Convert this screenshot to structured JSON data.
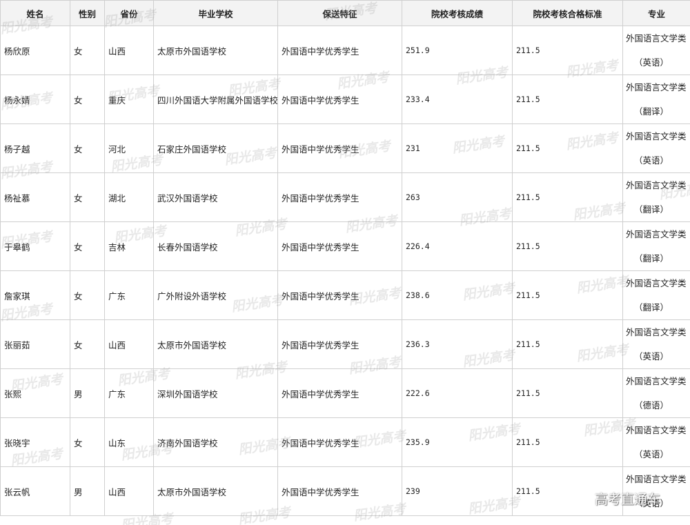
{
  "headers": {
    "name": "姓名",
    "gender": "性别",
    "province": "省份",
    "school": "毕业学校",
    "feature": "保送特征",
    "score": "院校考核成绩",
    "standard": "院校考核合格标准",
    "major": "专业"
  },
  "rows": [
    {
      "name": "杨欣原",
      "gender": "女",
      "province": "山西",
      "school": "太原市外国语学校",
      "feature": "外国语中学优秀学生",
      "score": "251.9",
      "standard": "211.5",
      "major": "外国语言文学类",
      "major_sub": "（英语）"
    },
    {
      "name": "杨永婧",
      "gender": "女",
      "province": "重庆",
      "school": "四川外国语大学附属外国语学校",
      "feature": "外国语中学优秀学生",
      "score": "233.4",
      "standard": "211.5",
      "major": "外国语言文学类",
      "major_sub": "（翻译）"
    },
    {
      "name": "杨子越",
      "gender": "女",
      "province": "河北",
      "school": "石家庄外国语学校",
      "feature": "外国语中学优秀学生",
      "score": "231",
      "standard": "211.5",
      "major": "外国语言文学类",
      "major_sub": "（英语）"
    },
    {
      "name": "杨祉慕",
      "gender": "女",
      "province": "湖北",
      "school": "武汉外国语学校",
      "feature": "外国语中学优秀学生",
      "score": "263",
      "standard": "211.5",
      "major": "外国语言文学类",
      "major_sub": "（翻译）"
    },
    {
      "name": "于皋鹤",
      "gender": "女",
      "province": "吉林",
      "school": "长春外国语学校",
      "feature": "外国语中学优秀学生",
      "score": "226.4",
      "standard": "211.5",
      "major": "外国语言文学类",
      "major_sub": "（翻译）"
    },
    {
      "name": "詹家琪",
      "gender": "女",
      "province": "广东",
      "school": "广外附设外语学校",
      "feature": "外国语中学优秀学生",
      "score": "238.6",
      "standard": "211.5",
      "major": "外国语言文学类",
      "major_sub": "（翻译）"
    },
    {
      "name": "张丽茹",
      "gender": "女",
      "province": "山西",
      "school": "太原市外国语学校",
      "feature": "外国语中学优秀学生",
      "score": "236.3",
      "standard": "211.5",
      "major": "外国语言文学类",
      "major_sub": "（英语）"
    },
    {
      "name": "张熙",
      "gender": "男",
      "province": "广东",
      "school": "深圳外国语学校",
      "feature": "外国语中学优秀学生",
      "score": "222.6",
      "standard": "211.5",
      "major": "外国语言文学类",
      "major_sub": "（德语）"
    },
    {
      "name": "张晓宇",
      "gender": "女",
      "province": "山东",
      "school": "济南外国语学校",
      "feature": "外国语中学优秀学生",
      "score": "235.9",
      "standard": "211.5",
      "major": "外国语言文学类",
      "major_sub": "（英语）"
    },
    {
      "name": "张云帆",
      "gender": "男",
      "province": "山西",
      "school": "太原市外国语学校",
      "feature": "外国语中学优秀学生",
      "score": "239",
      "standard": "211.5",
      "major": "外国语言文学类",
      "major_sub": "（英语）"
    }
  ],
  "watermark_text": "阳光高考",
  "brand_overlay": "高考直通车"
}
